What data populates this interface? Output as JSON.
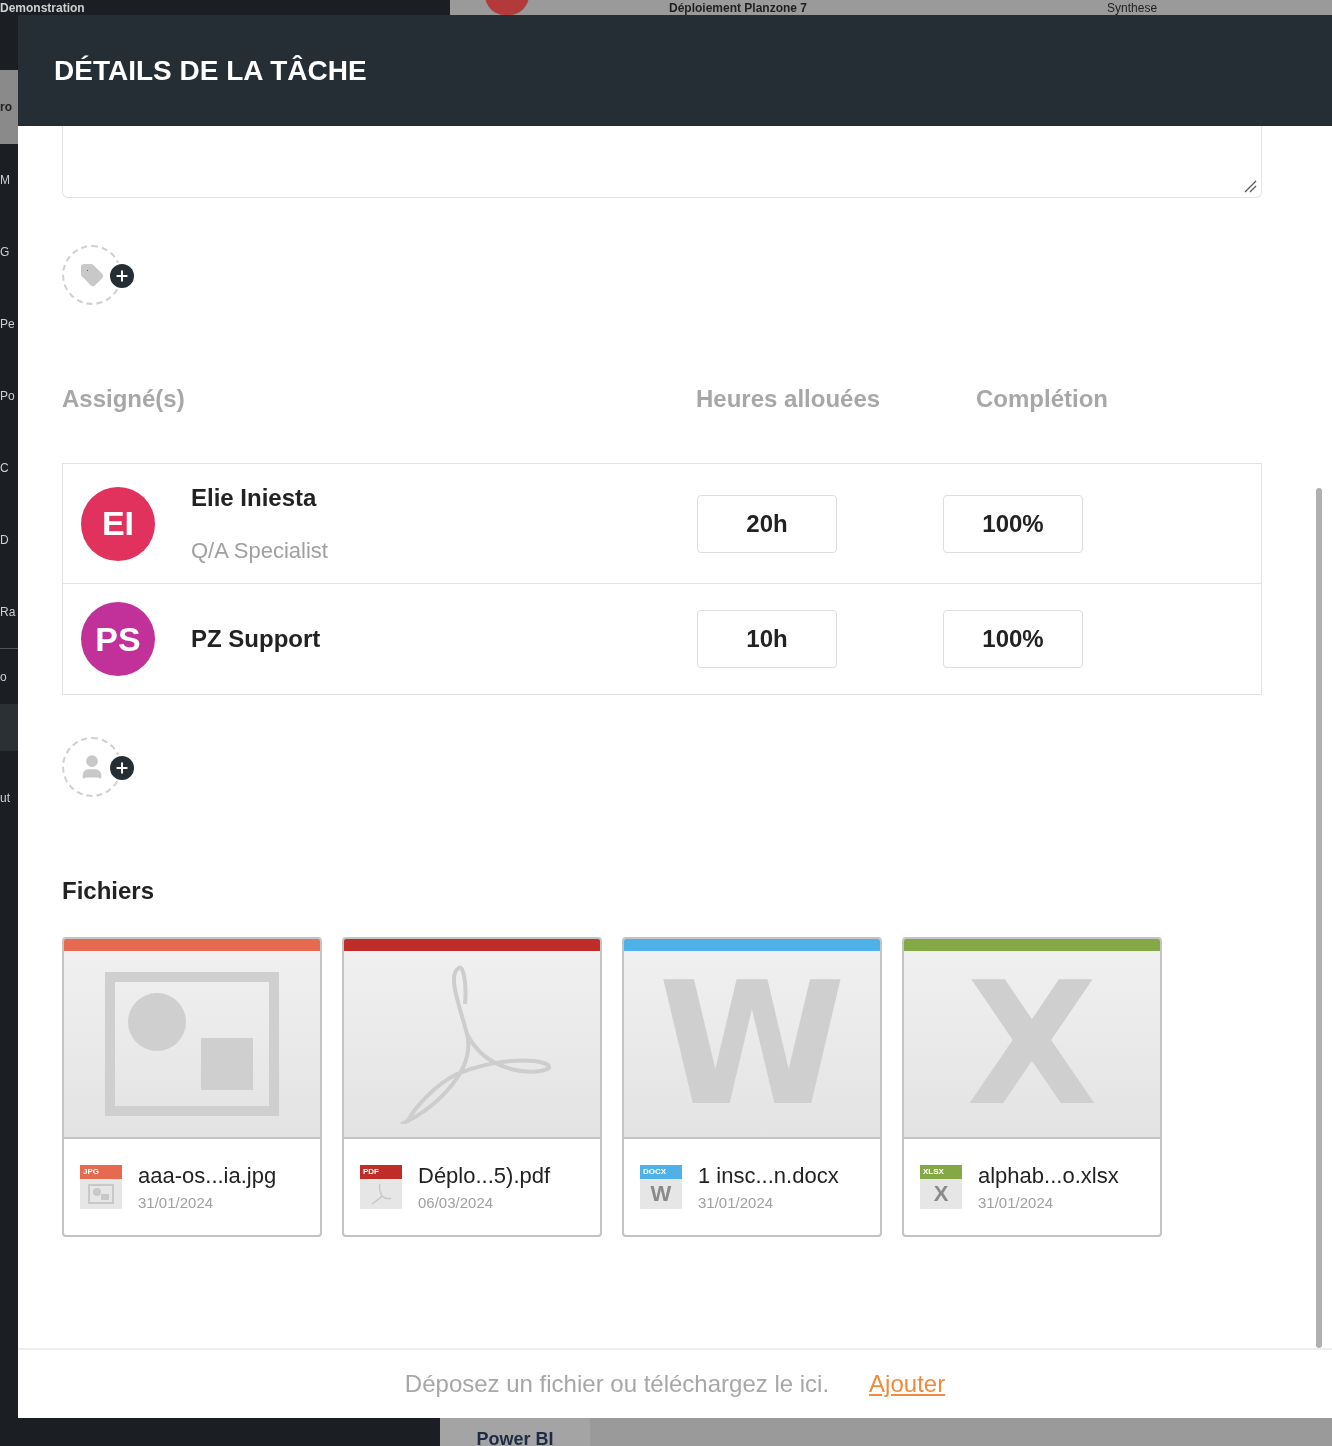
{
  "background": {
    "workspace_title": "Demonstration",
    "project_tab": "Déploiement Planzone 7",
    "view_tab": "Synthese",
    "sidebar_items": [
      "ro",
      "M",
      "G",
      "Pe",
      "Po",
      "C",
      "D",
      "Ra",
      "o",
      "ut"
    ],
    "bottom_tab": "Power BI"
  },
  "dialog": {
    "title": "DÉTAILS DE LA TÂCHE",
    "assignee_columns": [
      "Assigné(s)",
      "Heures allouées",
      "Complétion"
    ],
    "assignees": [
      {
        "initials": "EI",
        "name": "Elie Iniesta",
        "role": "Q/A Specialist",
        "color": "#e0325c",
        "hours": "20h",
        "completion": "100%"
      },
      {
        "initials": "PS",
        "name": "PZ Support",
        "color": "#c2309a",
        "hours": "10h",
        "completion": "100%"
      }
    ],
    "files_title": "Fichiers",
    "files": [
      {
        "kind": "image",
        "badge": "JPG",
        "color": "#e66a4f",
        "name": "aaa-os...ia.jpg",
        "date": "31/01/2024"
      },
      {
        "kind": "pdf",
        "badge": "PDF",
        "color": "#be2d28",
        "name": "Déplo...5).pdf",
        "date": "06/03/2024"
      },
      {
        "kind": "word",
        "badge": "DOCX",
        "glyph": "W",
        "icon_glyph": "W",
        "color": "#4fb1ea",
        "name": "1 insc...n.docx",
        "date": "31/01/2024"
      },
      {
        "kind": "excel",
        "badge": "XLSX",
        "glyph": "X",
        "icon_glyph": "X",
        "color": "#84a845",
        "name": "alphab...o.xlsx",
        "date": "31/01/2024"
      }
    ],
    "drop_text": "Déposez un fichier ou téléchargez le ici.",
    "add_link": "Ajouter"
  }
}
